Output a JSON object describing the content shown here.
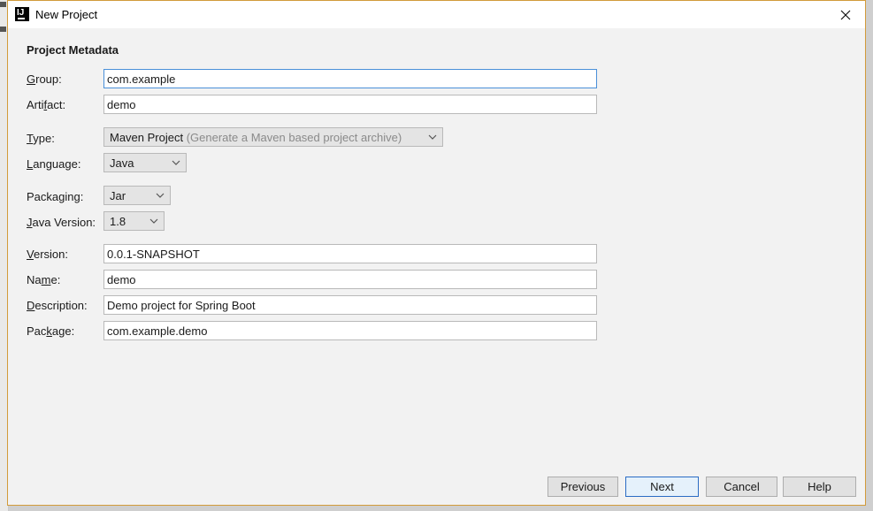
{
  "window": {
    "title": "New Project"
  },
  "section": {
    "title": "Project Metadata"
  },
  "fields": {
    "group": {
      "label_key": "G",
      "label_rest": "roup:",
      "value": "com.example"
    },
    "artifact": {
      "label_pre": "Arti",
      "label_key": "f",
      "label_rest": "act:",
      "value": "demo"
    },
    "version": {
      "label_key": "V",
      "label_rest": "ersion:",
      "value": "0.0.1-SNAPSHOT"
    },
    "name": {
      "label_pre": "Na",
      "label_key": "m",
      "label_rest": "e:",
      "value": "demo"
    },
    "description": {
      "label_key": "D",
      "label_rest": "escription:",
      "value": "Demo project for Spring Boot"
    },
    "package": {
      "label_pre": "Pac",
      "label_key": "k",
      "label_rest": "age:",
      "value": "com.example.demo"
    }
  },
  "selects": {
    "type": {
      "label_key": "T",
      "label_rest": "ype:",
      "value": "Maven Project",
      "hint": "(Generate a Maven based project archive)"
    },
    "language": {
      "label_key": "L",
      "label_rest": "anguage:",
      "value": "Java"
    },
    "packaging": {
      "label_pre": "Packa",
      "label_key": "g",
      "label_rest": "ing:",
      "value": "Jar"
    },
    "java_version": {
      "label_key": "J",
      "label_rest": "ava Version:",
      "value": "1.8"
    }
  },
  "buttons": {
    "previous": "Previous",
    "next": "Next",
    "cancel": "Cancel",
    "help": "Help"
  },
  "icons": {
    "app": "intellij-idea-icon",
    "close": "close-icon",
    "chevron": "chevron-down-icon"
  },
  "colors": {
    "focus_border": "#4a90d9",
    "default_button_border": "#2b6cc4",
    "window_border": "#d29b3a"
  }
}
